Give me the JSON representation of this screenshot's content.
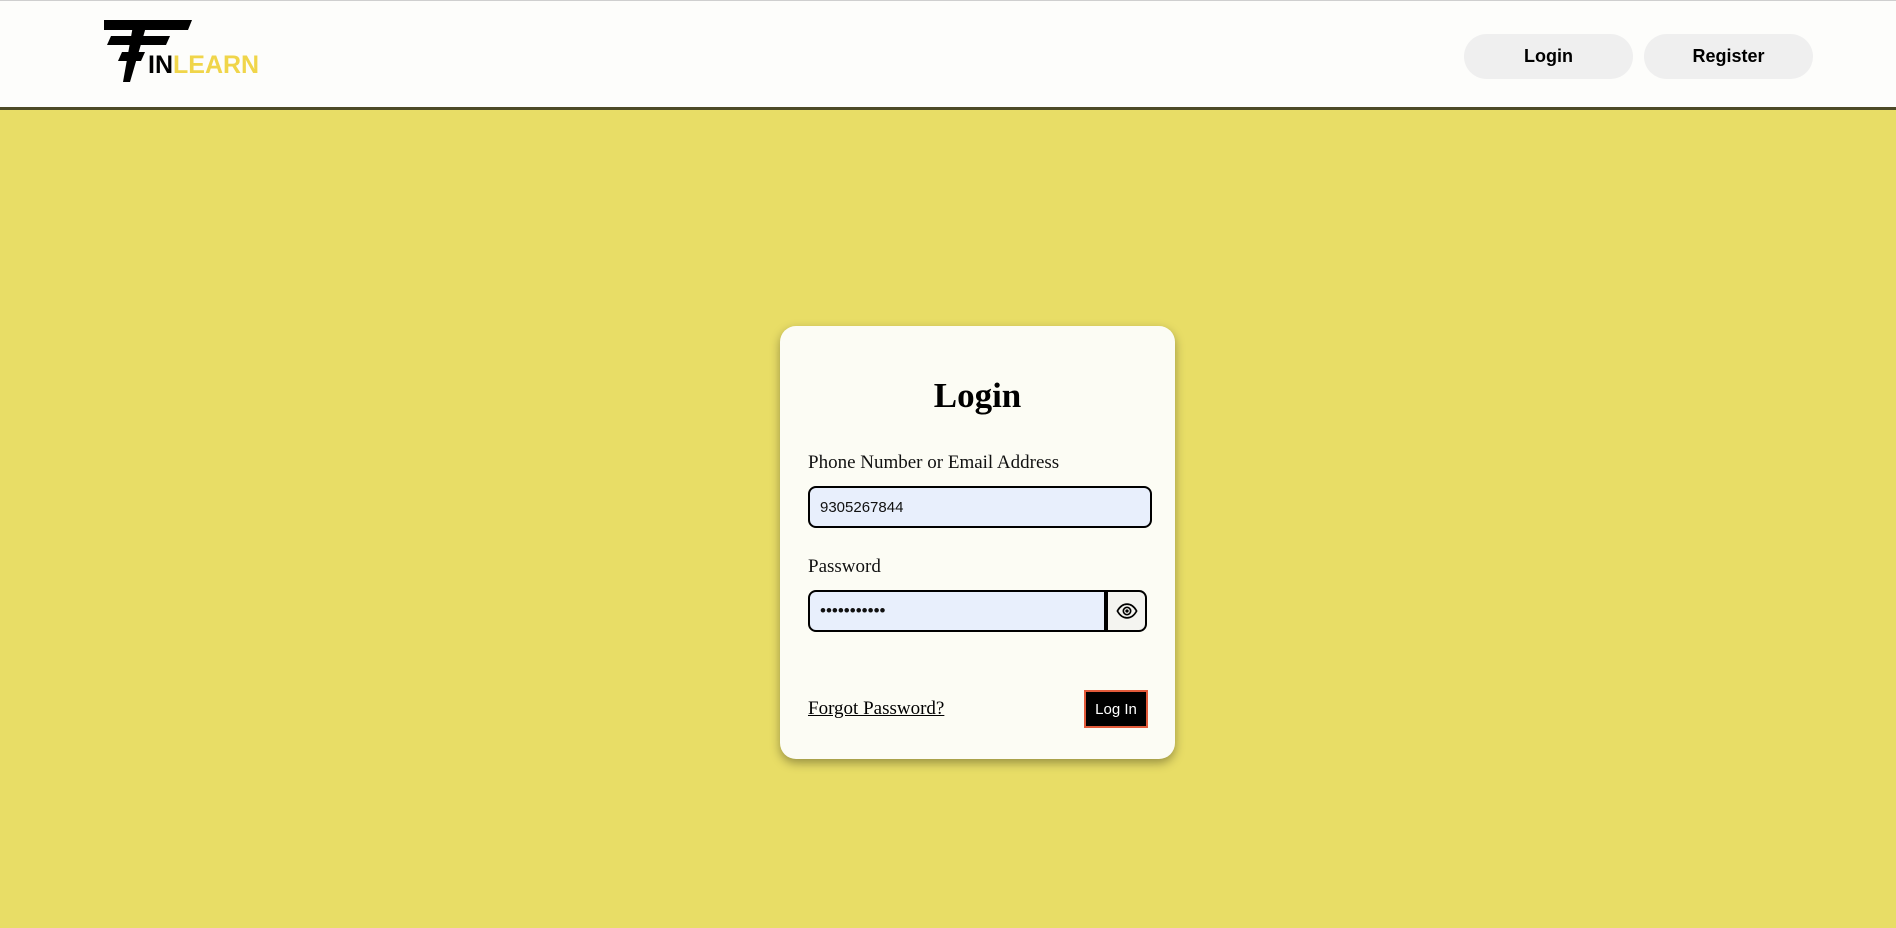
{
  "colors": {
    "page_background": "#e8dd66",
    "header_background": "#fdfdfb",
    "accent_yellow": "#f0d54a",
    "card_background": "#fcfcf4",
    "input_background": "#e8effc",
    "login_button_border": "#e25a3a"
  },
  "header": {
    "logo": {
      "text_in": "IN",
      "text_learn": "LEARN",
      "icon": "finlearn-logo-icon"
    },
    "nav": {
      "login_label": "Login",
      "register_label": "Register"
    }
  },
  "login_form": {
    "title": "Login",
    "username_label": "Phone Number or Email Address",
    "username_value": "9305267844",
    "password_label": "Password",
    "password_value": "•••••••••••",
    "show_password_icon": "eye-icon",
    "forgot_password_label": "Forgot Password?",
    "submit_label": "Log In"
  }
}
